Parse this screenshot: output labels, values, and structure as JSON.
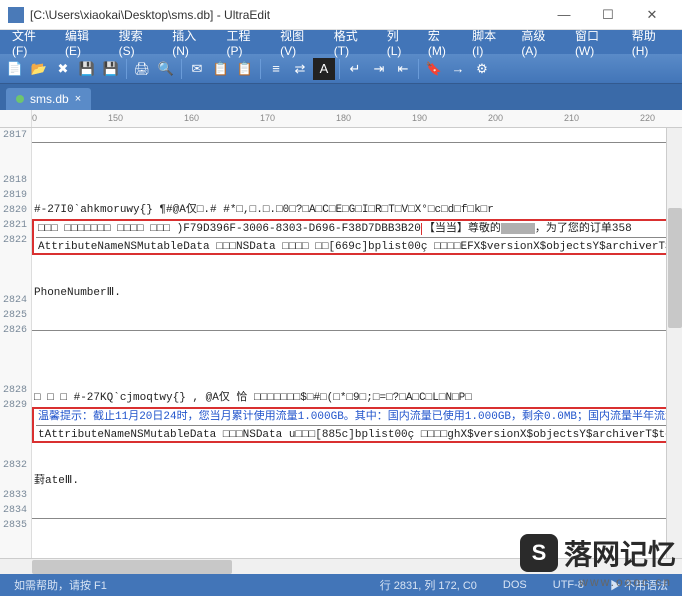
{
  "window": {
    "title": "[C:\\Users\\xiaokai\\Desktop\\sms.db] - UltraEdit"
  },
  "menu": {
    "file": "文件(F)",
    "edit": "编辑(E)",
    "search": "搜索(S)",
    "insert": "插入(N)",
    "project": "工程(P)",
    "view": "视图(V)",
    "format": "格式(T)",
    "column": "列(L)",
    "macro": "宏(M)",
    "script": "脚本(I)",
    "advanced": "高级(A)",
    "window": "窗口(W)",
    "help": "帮助(H)"
  },
  "tab": {
    "name": "sms.db",
    "close": "×"
  },
  "ruler": {
    "marks": [
      "0",
      "150",
      "160",
      "170",
      "180",
      "190",
      "200",
      "210",
      "220"
    ]
  },
  "lines": {
    "n2817": "2817",
    "n2818": "2818",
    "n2819": "2819",
    "n2820": "2820",
    "n2821": "2821",
    "n2822": "2822",
    "n2824": "2824",
    "n2825": "2825",
    "n2826": "2826",
    "n2828": "2828",
    "n2829": "2829",
    "n2832": "2832",
    "n2833": "2833",
    "n2834": "2834",
    "n2835": "2835",
    "l2820": "#-27I0`ahkmoruwy{}      ¶#@A仅□.# #*□,□.□.□0□?□A□C□E□G□I□R□T□V□X°□c□d□f□k□r",
    "l2821a": "□□□ □□□□□□□  □□□□  □□□  )F79D396F-3006-8303-D696-F38D7DBB3B20",
    "l2821b": "【当当】尊敬的",
    "l2821c": "，为了您的订单358",
    "l2822": "AttributeNameNSMutableData □□□NSData □□□□ □□[669c]bplist00ç □□□□EFX$versionX$objectsY$archiverT$top□",
    "l2824": "PhoneNumberⅢ.",
    "l2829": "□ □ □ #-27KQ`cjmoqtwy{}     , @A仅 恰   □□□□□□□$□#□(□*□9□;□=□?□A□C□L□N□P□",
    "l2830": "温馨提示：截止11月20日24时，您当月累计使用流量1.000GB。其中：国内流量已使用1.000GB，剩余0.0MB；国内流量半年流量包",
    "l2831": "tAttributeNameNSMutableData □□□NSData u□□□[885c]bplist00ç □□□□ghX$versionX$objectsY$archiverT$top□",
    "l2833": "葑ateⅢ."
  },
  "status": {
    "help": "如需帮助，请按 F1",
    "pos": "行 2831, 列 172, C0",
    "mode": "DOS",
    "encoding": "UTF-8",
    "grammar": "▶ 不用语法"
  },
  "watermark": {
    "main": "落网记忆",
    "sub": "www.oooc.cn"
  }
}
